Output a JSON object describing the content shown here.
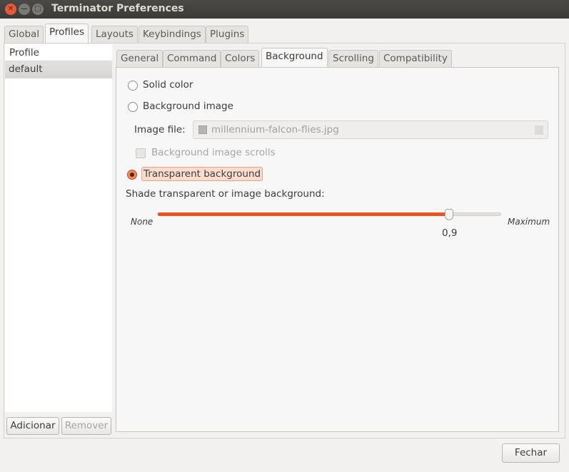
{
  "window": {
    "title": "Terminator Preferences"
  },
  "main_tabs": [
    {
      "label": "Global"
    },
    {
      "label": "Profiles",
      "active": true
    },
    {
      "label": "Layouts"
    },
    {
      "label": "Keybindings"
    },
    {
      "label": "Plugins"
    }
  ],
  "profiles": {
    "header": "Profile",
    "items": [
      "default"
    ],
    "add_label": "Adicionar",
    "remove_label": "Remover"
  },
  "profile_tabs": [
    {
      "label": "General"
    },
    {
      "label": "Command"
    },
    {
      "label": "Colors"
    },
    {
      "label": "Background",
      "active": true
    },
    {
      "label": "Scrolling"
    },
    {
      "label": "Compatibility"
    }
  ],
  "background": {
    "solid_color": "Solid color",
    "background_image": "Background image",
    "image_file_label": "Image file:",
    "image_file_value": "millennium-falcon-flies.jpg",
    "scrolls_label": "Background image scrolls",
    "transparent": "Transparent background",
    "selected": "transparent",
    "shade_label": "Shade transparent or image background:",
    "shade_min": "None",
    "shade_max": "Maximum",
    "shade_value": 0.9,
    "shade_value_text": "0,9"
  },
  "close_label": "Fechar",
  "colors": {
    "accent": "#e95420"
  }
}
